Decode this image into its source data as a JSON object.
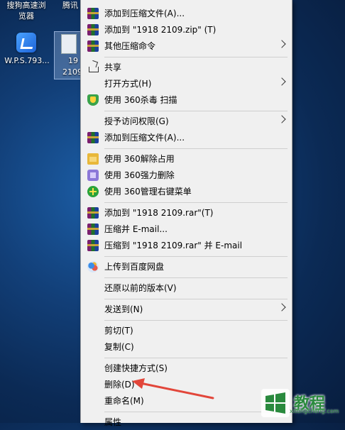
{
  "desktop": {
    "top_labels": [
      "搜狗高速浏",
      "览器",
      "腾讯"
    ],
    "wps_label": "W.P.S.793...",
    "file_label_1": "19",
    "file_label_2": "2109"
  },
  "menu": {
    "items": [
      {
        "label": "添加到压缩文件(A)...",
        "icon": "winrar-icon"
      },
      {
        "label": "添加到 \"1918 2109.zip\" (T)",
        "icon": "winrar-icon"
      },
      {
        "label": "其他压缩命令",
        "icon": "winrar-icon",
        "submenu": true
      },
      {
        "label": "共享",
        "icon": "share-icon"
      },
      {
        "label": "打开方式(H)",
        "icon": "",
        "submenu": true
      },
      {
        "label": "使用 360杀毒 扫描",
        "icon": "360-shield-icon"
      },
      {
        "label": "授予访问权限(G)",
        "icon": "",
        "submenu": true
      },
      {
        "label": "添加到压缩文件(A)...",
        "icon": "winrar-icon"
      },
      {
        "label": "使用 360解除占用",
        "icon": "360-unlock-icon"
      },
      {
        "label": "使用 360强力删除",
        "icon": "360-delete-icon"
      },
      {
        "label": "使用 360管理右键菜单",
        "icon": "360-manage-icon"
      },
      {
        "label": "添加到 \"1918 2109.rar\"(T)",
        "icon": "winrar-icon"
      },
      {
        "label": "压缩并 E-mail...",
        "icon": "winrar-icon"
      },
      {
        "label": "压缩到 \"1918 2109.rar\" 并 E-mail",
        "icon": "winrar-icon"
      },
      {
        "label": "上传到百度网盘",
        "icon": "baidu-netdisk-icon"
      },
      {
        "label": "还原以前的版本(V)",
        "icon": ""
      },
      {
        "label": "发送到(N)",
        "icon": "",
        "submenu": true
      },
      {
        "label": "剪切(T)",
        "icon": ""
      },
      {
        "label": "复制(C)",
        "icon": ""
      },
      {
        "label": "创建快捷方式(S)",
        "icon": ""
      },
      {
        "label": "删除(D)",
        "icon": ""
      },
      {
        "label": "重命名(M)",
        "icon": ""
      },
      {
        "label": "属性",
        "icon": ""
      }
    ]
  },
  "watermark": {
    "text": "教程",
    "url": "xitongcheng.com"
  },
  "colors": {
    "menu_bg": "#f0f0f0",
    "annotation_arrow": "#e2463a",
    "desktop_bg": "#123f78"
  }
}
